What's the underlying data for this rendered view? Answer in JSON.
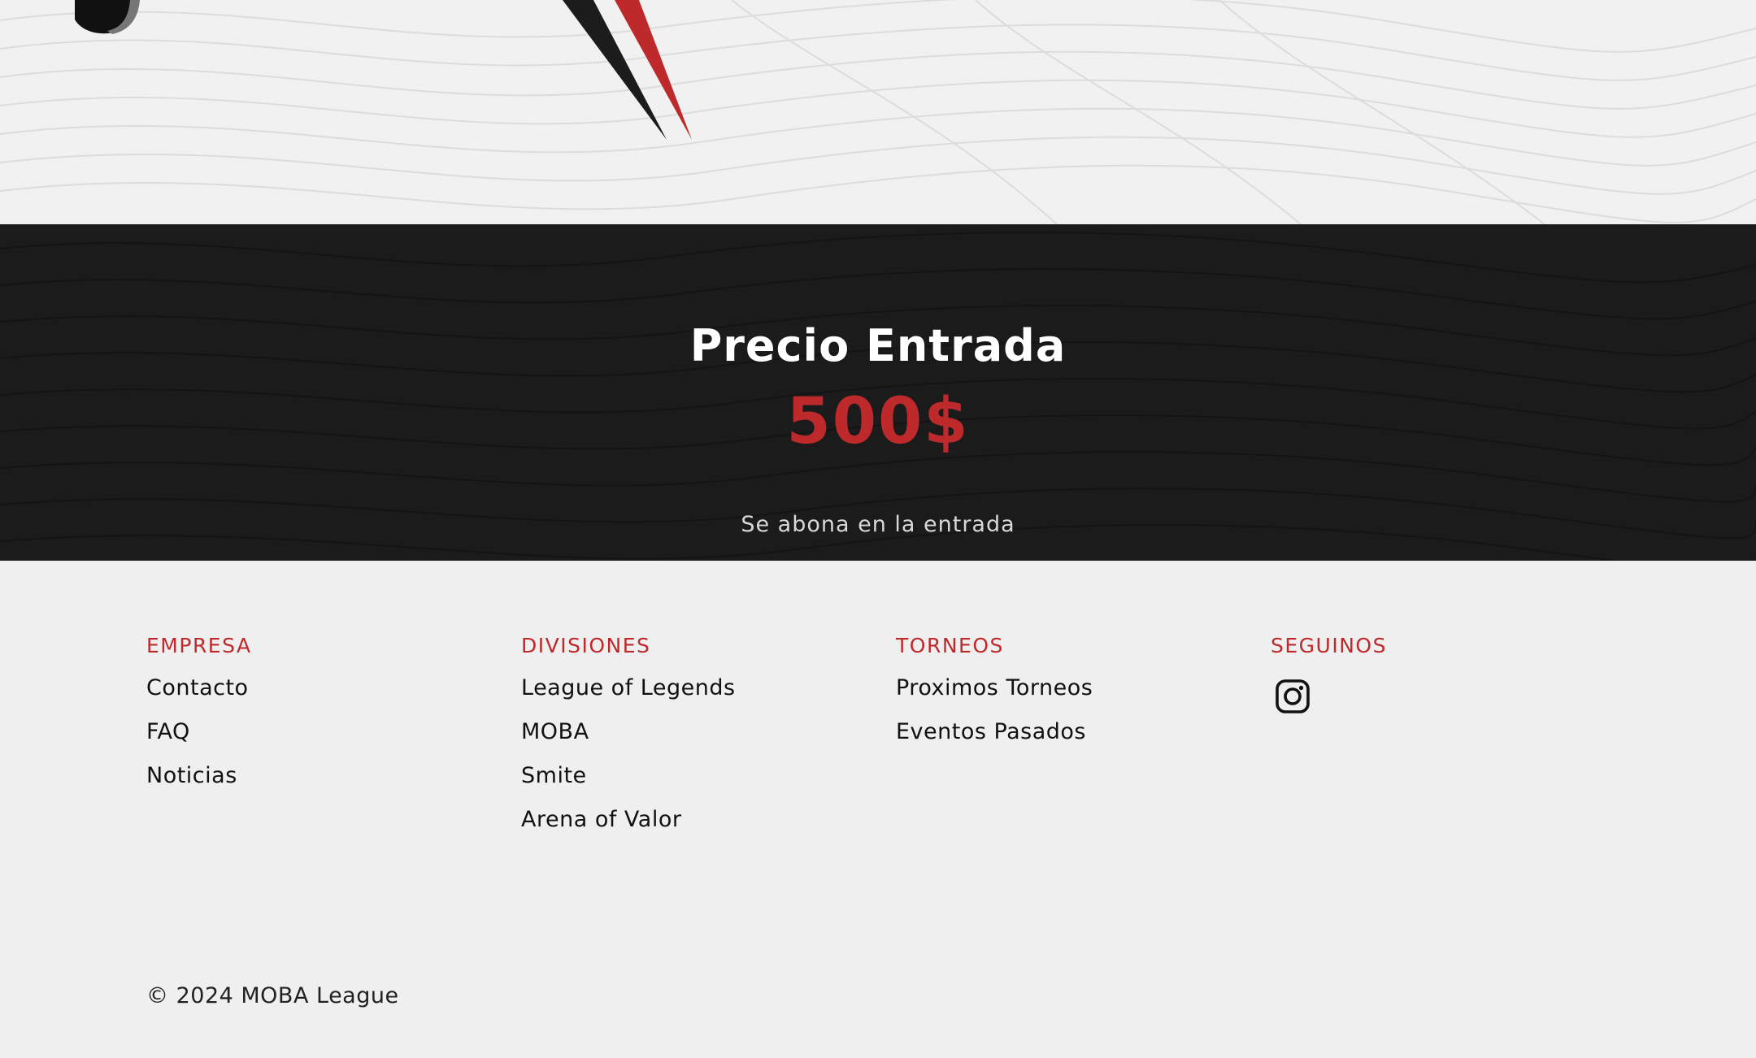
{
  "colors": {
    "accent": "#be2a2b",
    "dark_band": "#1b1b1b",
    "light_bg": "#efefef"
  },
  "price_section": {
    "title": "Precio Entrada",
    "value": "500$",
    "note": "Se abona en la entrada"
  },
  "footer": {
    "columns": [
      {
        "title": "EMPRESA",
        "links": [
          "Contacto",
          "FAQ",
          "Noticias"
        ]
      },
      {
        "title": "DIVISIONES",
        "links": [
          "League of Legends",
          "MOBA",
          "Smite",
          "Arena of Valor"
        ]
      },
      {
        "title": "TORNEOS",
        "links": [
          "Proximos Torneos",
          "Eventos Pasados"
        ]
      },
      {
        "title": "SEGUINOS",
        "icon": "instagram-icon"
      }
    ],
    "copyright": "© 2024 MOBA League"
  }
}
